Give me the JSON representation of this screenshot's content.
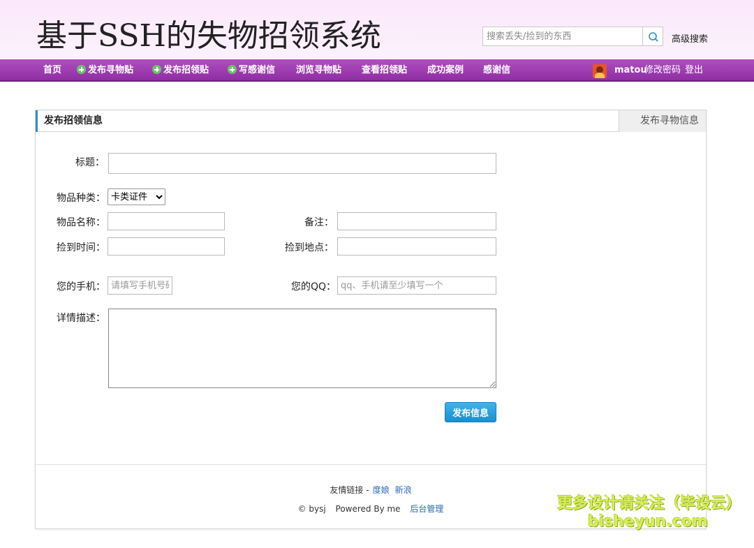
{
  "header": {
    "site_title": "基于SSH的失物招领系统",
    "search_placeholder": "搜索丢失/捡到的东西",
    "advanced_search": "高级搜索"
  },
  "nav": {
    "items": [
      {
        "label": "首页",
        "icon": ""
      },
      {
        "label": "发布寻物贴",
        "icon": "plus-circle-icon"
      },
      {
        "label": "发布招领贴",
        "icon": "plus-circle-icon"
      },
      {
        "label": "写感谢信",
        "icon": "plus-circle-icon"
      },
      {
        "label": "浏览寻物贴",
        "icon": ""
      },
      {
        "label": "查看招领贴",
        "icon": ""
      },
      {
        "label": "成功案例",
        "icon": ""
      },
      {
        "label": "感谢信",
        "icon": ""
      }
    ],
    "username": "matou",
    "change_password": "修改密码",
    "logout": "登出"
  },
  "panel": {
    "title": "发布招领信息",
    "alt_tab": "发布寻物信息"
  },
  "form": {
    "title_label": "标题：",
    "category_label": "物品种类：",
    "category_selected": "卡类证件",
    "name_label": "物品名称：",
    "remark_label": "备注：",
    "time_label": "捡到时间：",
    "place_label": "捡到地点：",
    "phone_label": "您的手机：",
    "phone_placeholder": "请填写手机号码",
    "qq_label": "您的QQ：",
    "qq_placeholder": "qq、手机请至少填写一个",
    "detail_label": "详情描述：",
    "submit": "发布信息"
  },
  "footer": {
    "links_label": "友情链接 -",
    "links": [
      "度娘",
      "新浪"
    ],
    "copyright": "© bysj",
    "powered": "Powered By me",
    "admin": "后台管理"
  },
  "watermark": {
    "line1": "更多设计请关注（毕设云）",
    "line2": "bisheyun.com"
  },
  "colors": {
    "nav_bg": "#9b3bb0",
    "accent_bar": "#2f8fd0",
    "button": "#1f9ad9",
    "link": "#2a6ab5"
  }
}
